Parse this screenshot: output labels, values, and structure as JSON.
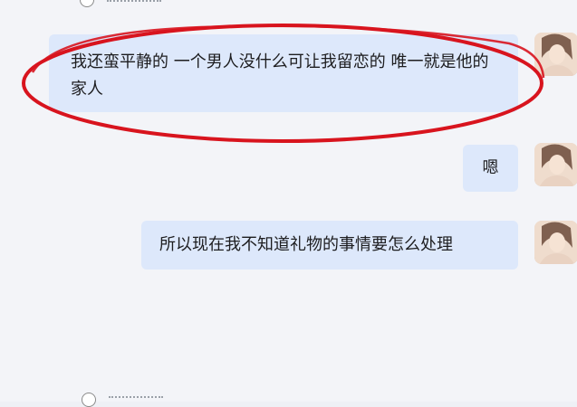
{
  "messages": [
    {
      "text": "我还蛮平静的 一个男人没什么可让我留恋的 唯一就是他的家人"
    },
    {
      "text": "嗯"
    },
    {
      "text": "所以现在我不知道礼物的事情要怎么处理"
    }
  ],
  "icons": {
    "avatar": "user-avatar-icon",
    "top_control": "radio-circle-icon",
    "bottom_control": "radio-circle-icon"
  },
  "colors": {
    "bubble": "#dde8fb",
    "annotation": "#d8141e",
    "background": "#f3f4f8"
  }
}
